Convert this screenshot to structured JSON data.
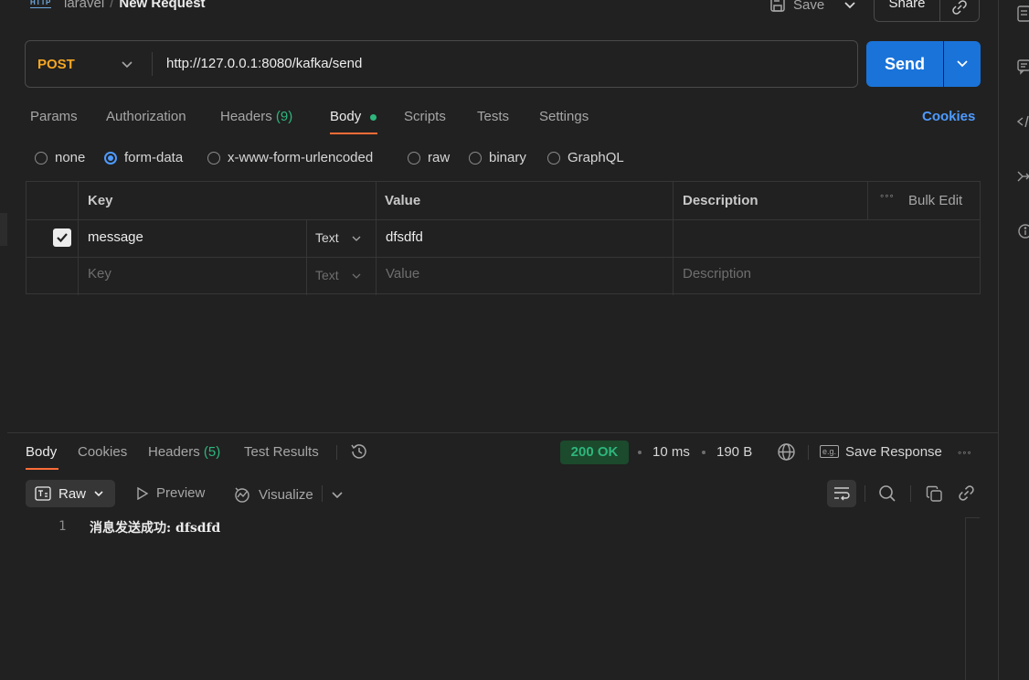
{
  "header": {
    "protocol_badge": "HTTP",
    "collection": "laravel",
    "separator": "/",
    "request_name": "New Request",
    "save_label": "Save",
    "share_label": "Share"
  },
  "request": {
    "method": "POST",
    "url": "http://127.0.0.1:8080/kafka/send",
    "send_label": "Send"
  },
  "tabs": {
    "params": "Params",
    "authorization": "Authorization",
    "headers": "Headers",
    "headers_count": "(9)",
    "body": "Body",
    "scripts": "Scripts",
    "tests": "Tests",
    "settings": "Settings",
    "cookies": "Cookies"
  },
  "body_types": {
    "none": "none",
    "form_data": "form-data",
    "urlencoded": "x-www-form-urlencoded",
    "raw": "raw",
    "binary": "binary",
    "graphql": "GraphQL",
    "selected": "form-data"
  },
  "table": {
    "headers": {
      "key": "Key",
      "value": "Value",
      "description": "Description",
      "bulk_edit": "Bulk Edit"
    },
    "rows": [
      {
        "checked": true,
        "key": "message",
        "type": "Text",
        "value": "dfsdfd",
        "description": ""
      }
    ],
    "placeholder": {
      "key": "Key",
      "type": "Text",
      "value": "Value",
      "description": "Description"
    }
  },
  "response": {
    "tabs": {
      "body": "Body",
      "cookies": "Cookies",
      "headers": "Headers",
      "headers_count": "(5)",
      "test_results": "Test Results"
    },
    "status": "200 OK",
    "time": "10 ms",
    "size": "190 B",
    "save_response": "Save Response",
    "eg_badge": "e.g.",
    "format": "Raw",
    "preview": "Preview",
    "visualize": "Visualize",
    "line_number": "1",
    "content": "消息发送成功: dfsdfd"
  },
  "colors": {
    "background": "#212121",
    "accent_orange": "#ff6c37",
    "method_post": "#f5a623",
    "send_blue": "#1a73d9",
    "success_green": "#2eb67d",
    "link_blue": "#4e9bff"
  }
}
